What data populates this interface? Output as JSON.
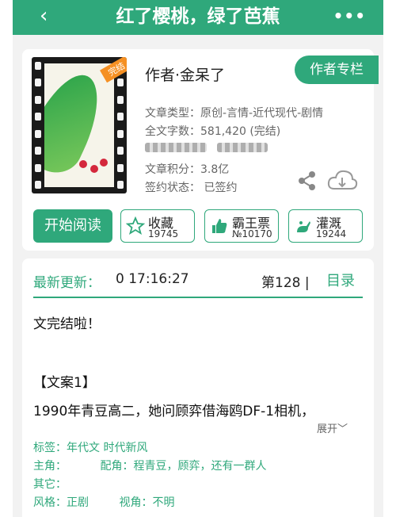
{
  "header": {
    "title": "红了樱桃，绿了芭蕉",
    "back_icon": "‹",
    "more_icon": "•••"
  },
  "book": {
    "cover_tag": "完结",
    "author_line": "作者·金呆了",
    "author_column_button": "作者专栏",
    "type_line": "文章类型：原创-言情-近代现代-剧情",
    "wordcount_line": "全文字数：581,420 (完结)",
    "score_line": "文章积分：3.8亿",
    "sign_line": "签约状态： 已签约"
  },
  "actions": {
    "read": "开始阅读",
    "collect": {
      "label": "收藏",
      "count": "19745"
    },
    "bawang": {
      "label": "霸王票",
      "count": "№10170"
    },
    "irrigate": {
      "label": "灌溉",
      "count": "19244"
    }
  },
  "update": {
    "label": "最新更新：",
    "time": "0 17:16:27",
    "chapter": "第128 |",
    "toc": "目录"
  },
  "intro": {
    "line1": "文完结啦！",
    "line2": "【文案1】",
    "line3": "1990年青豆高二，她问顾弈借海鸥DF-1相机，",
    "expand": "展开﹀"
  },
  "details": {
    "tags_key": "标签：",
    "tags_val": "年代文  时代新风",
    "lead_key": "主角：",
    "support_key": "配角：",
    "support_val": "程青豆，顾弈，还有一群人",
    "other_key": "其它：",
    "style_key": "风格：",
    "style_val": "正剧",
    "view_key": "视角：",
    "view_val": "不明"
  },
  "colors": {
    "accent": "#2fa87b"
  }
}
